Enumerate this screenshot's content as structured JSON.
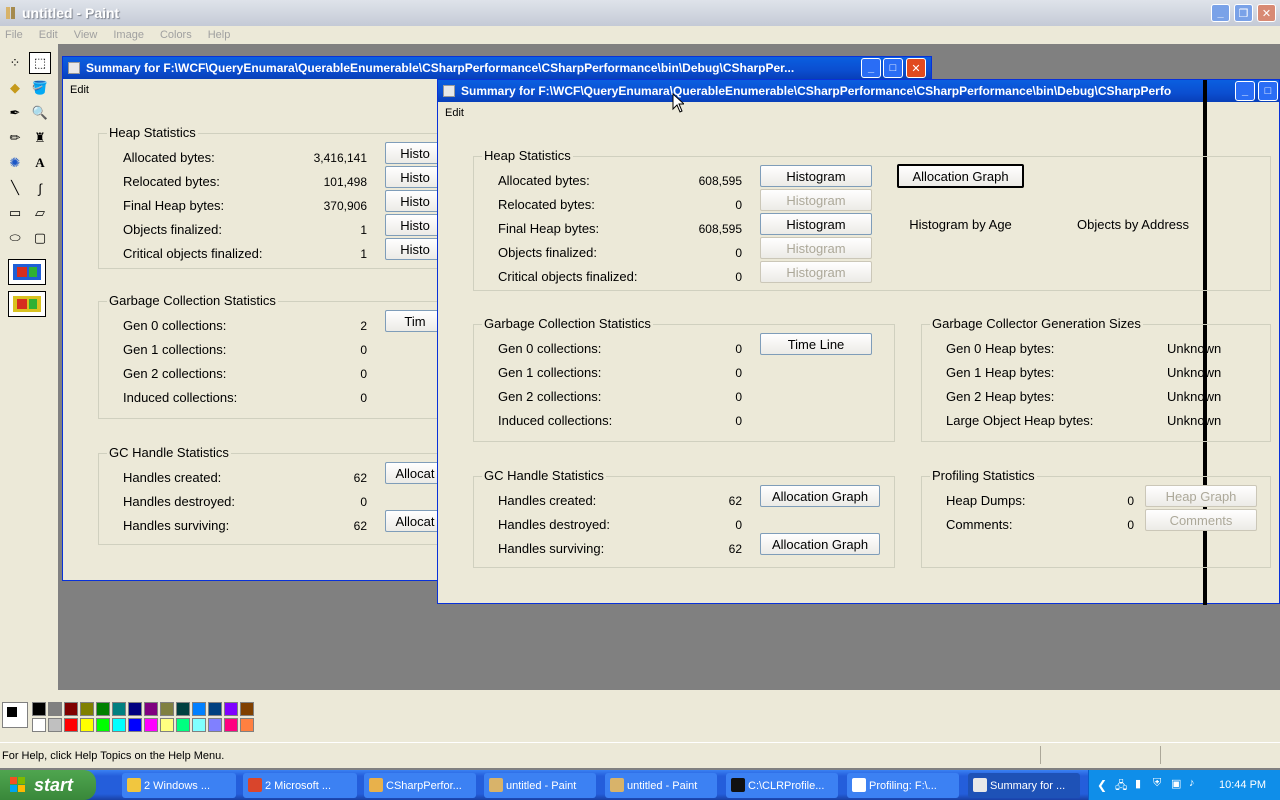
{
  "paint": {
    "title": "untitled - Paint",
    "menu": [
      "File",
      "Edit",
      "View",
      "Image",
      "Colors",
      "Help"
    ],
    "status": "For Help, click Help Topics on the Help Menu.",
    "palette_top": [
      "#000000",
      "#808080",
      "#800000",
      "#808000",
      "#008000",
      "#008080",
      "#000080",
      "#800080",
      "#808040",
      "#004040",
      "#0080ff",
      "#004080",
      "#8000ff",
      "#804000"
    ],
    "palette_bottom": [
      "#ffffff",
      "#c0c0c0",
      "#ff0000",
      "#ffff00",
      "#00ff00",
      "#00ffff",
      "#0000ff",
      "#ff00ff",
      "#ffff80",
      "#00ff80",
      "#80ffff",
      "#8080ff",
      "#ff0080",
      "#ff8040"
    ]
  },
  "back_window": {
    "title": "Summary for F:\\WCF\\QueryEnumara\\QuerableEnumerable\\CSharpPerformance\\CSharpPerformance\\bin\\Debug\\CSharpPer...",
    "menu": "Edit",
    "heap": {
      "title": "Heap Statistics",
      "rows": [
        {
          "label": "Allocated bytes:",
          "value": "3,416,141",
          "btn": "Histo"
        },
        {
          "label": "Relocated bytes:",
          "value": "101,498",
          "btn": "Histo"
        },
        {
          "label": "Final Heap bytes:",
          "value": "370,906",
          "btn": "Histo"
        },
        {
          "label": "Objects finalized:",
          "value": "1",
          "btn": "Histo"
        },
        {
          "label": "Critical objects finalized:",
          "value": "1",
          "btn": "Histo"
        }
      ]
    },
    "gc": {
      "title": "Garbage Collection Statistics",
      "rows": [
        {
          "label": "Gen 0 collections:",
          "value": "2"
        },
        {
          "label": "Gen 1 collections:",
          "value": "0"
        },
        {
          "label": "Gen 2 collections:",
          "value": "0"
        },
        {
          "label": "Induced collections:",
          "value": "0"
        }
      ],
      "btn": "Tim"
    },
    "handles": {
      "title": "GC Handle Statistics",
      "rows": [
        {
          "label": "Handles created:",
          "value": "62",
          "btn": "Allocat"
        },
        {
          "label": "Handles destroyed:",
          "value": "0",
          "btn": ""
        },
        {
          "label": "Handles surviving:",
          "value": "62",
          "btn": "Allocat"
        }
      ]
    }
  },
  "front_window": {
    "title": "Summary for F:\\WCF\\QueryEnumara\\QuerableEnumerable\\CSharpPerformance\\CSharpPerformance\\bin\\Debug\\CSharpPerfo",
    "menu": "Edit",
    "heap": {
      "title": "Heap Statistics",
      "rows": [
        {
          "label": "Allocated bytes:",
          "value": "608,595",
          "btn": "Histogram",
          "enabled": true
        },
        {
          "label": "Relocated bytes:",
          "value": "0",
          "btn": "Histogram",
          "enabled": false
        },
        {
          "label": "Final Heap bytes:",
          "value": "608,595",
          "btn": "Histogram",
          "enabled": true
        },
        {
          "label": "Objects finalized:",
          "value": "0",
          "btn": "Histogram",
          "enabled": false
        },
        {
          "label": "Critical objects finalized:",
          "value": "0",
          "btn": "Histogram",
          "enabled": false
        }
      ],
      "allocation_graph": "Allocation Graph",
      "histogram_by_age": "Histogram by Age",
      "objects_by_address": "Objects by Address"
    },
    "gc": {
      "title": "Garbage Collection Statistics",
      "rows": [
        {
          "label": "Gen 0 collections:",
          "value": "0"
        },
        {
          "label": "Gen 1 collections:",
          "value": "0"
        },
        {
          "label": "Gen 2 collections:",
          "value": "0"
        },
        {
          "label": "Induced collections:",
          "value": "0"
        }
      ],
      "timeline": "Time Line"
    },
    "gen_sizes": {
      "title": "Garbage Collector Generation Sizes",
      "rows": [
        {
          "label": "Gen 0 Heap bytes:",
          "value": "Unknown"
        },
        {
          "label": "Gen 1 Heap bytes:",
          "value": "Unknown"
        },
        {
          "label": "Gen 2 Heap bytes:",
          "value": "Unknown"
        },
        {
          "label": "Large Object Heap bytes:",
          "value": "Unknown"
        }
      ]
    },
    "handles": {
      "title": "GC Handle Statistics",
      "rows": [
        {
          "label": "Handles created:",
          "value": "62",
          "btn": "Allocation Graph"
        },
        {
          "label": "Handles destroyed:",
          "value": "0",
          "btn": ""
        },
        {
          "label": "Handles surviving:",
          "value": "62",
          "btn": "Allocation Graph"
        }
      ]
    },
    "profiling": {
      "title": "Profiling Statistics",
      "rows": [
        {
          "label": "Heap Dumps:",
          "value": "0",
          "btn": "Heap Graph"
        },
        {
          "label": "Comments:",
          "value": "0",
          "btn": "Comments"
        }
      ]
    }
  },
  "taskbar": {
    "start": "start",
    "items": [
      "2 Windows ...",
      "2 Microsoft ...",
      "CSharpPerfor...",
      "untitled - Paint",
      "untitled - Paint",
      "C:\\CLRProfile...",
      "Profiling: F:\\...",
      "Summary for ..."
    ],
    "clock": "10:44 PM"
  }
}
